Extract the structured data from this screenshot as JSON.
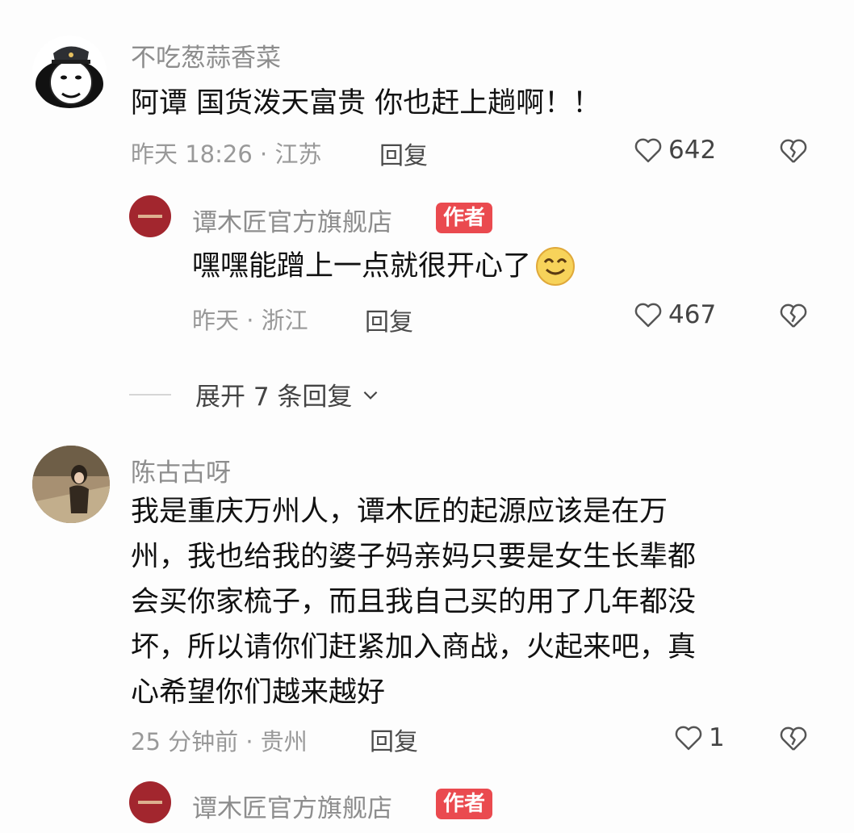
{
  "comments": [
    {
      "username": "不吃葱蒜香菜",
      "text": "阿谭 国货泼天富贵 你也赶上趟啊！！",
      "meta": "昨天 18:26 · 江苏",
      "reply_label": "回复",
      "likes": "642"
    },
    {
      "username": "谭木匠官方旗舰店",
      "badge": "作者",
      "text": "嘿嘿能蹭上一点就很开心了",
      "emoji": "smile-emoji-icon",
      "meta": "昨天 · 浙江",
      "reply_label": "回复",
      "likes": "467"
    },
    {
      "username": "陈古古呀",
      "text_lines": [
        "我是重庆万州人，谭木匠的起源应该是在万",
        "州，我也给我的婆子妈亲妈只要是女生长辈都",
        "会买你家梳子，而且我自己买的用了几年都没",
        "坏，所以请你们赶紧加入商战，火起来吧，真",
        "心希望你们越来越好"
      ],
      "meta": "25 分钟前 · 贵州",
      "reply_label": "回复",
      "likes": "1"
    },
    {
      "username": "谭木匠官方旗舰店",
      "badge": "作者"
    }
  ],
  "expand_replies_label": "展开 7 条回复",
  "colors": {
    "badge": "#ea4a4f",
    "shop_avatar": "#a2262e",
    "muted_text": "#999999"
  }
}
